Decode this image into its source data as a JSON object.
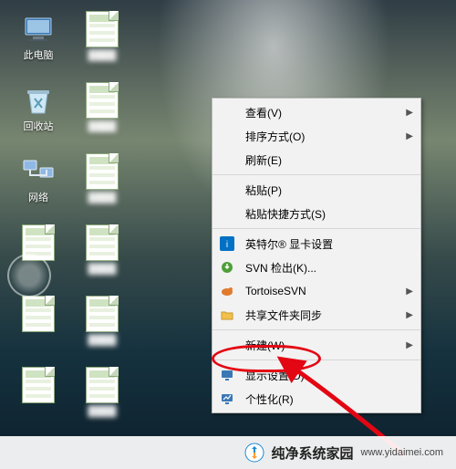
{
  "desktop_icons": {
    "col1": [
      {
        "name": "pc",
        "label": "此电脑"
      },
      {
        "name": "bin",
        "label": "回收站"
      },
      {
        "name": "net",
        "label": "网络"
      },
      {
        "name": "xls1",
        "label": ""
      },
      {
        "name": "xls2",
        "label": ""
      },
      {
        "name": "xls3",
        "label": ""
      }
    ],
    "col2": [
      {
        "name": "f1",
        "label": ""
      },
      {
        "name": "f2",
        "label": ""
      },
      {
        "name": "f3",
        "label": ""
      },
      {
        "name": "f4",
        "label": ""
      },
      {
        "name": "f5",
        "label": ""
      },
      {
        "name": "f6",
        "label": ""
      }
    ]
  },
  "context_menu": {
    "view": "查看(V)",
    "sort": "排序方式(O)",
    "refresh": "刷新(E)",
    "paste": "粘贴(P)",
    "paste_short": "粘贴快捷方式(S)",
    "intel": "英特尔® 显卡设置",
    "svn_checkout": "SVN 检出(K)...",
    "tortoise": "TortoiseSVN",
    "share": "共享文件夹同步",
    "new": "新建(W)",
    "display": "显示设置(D)",
    "personalize": "个性化(R)"
  },
  "watermark": {
    "brand": "纯净系统家园",
    "url": "www.yidaimei.com"
  }
}
